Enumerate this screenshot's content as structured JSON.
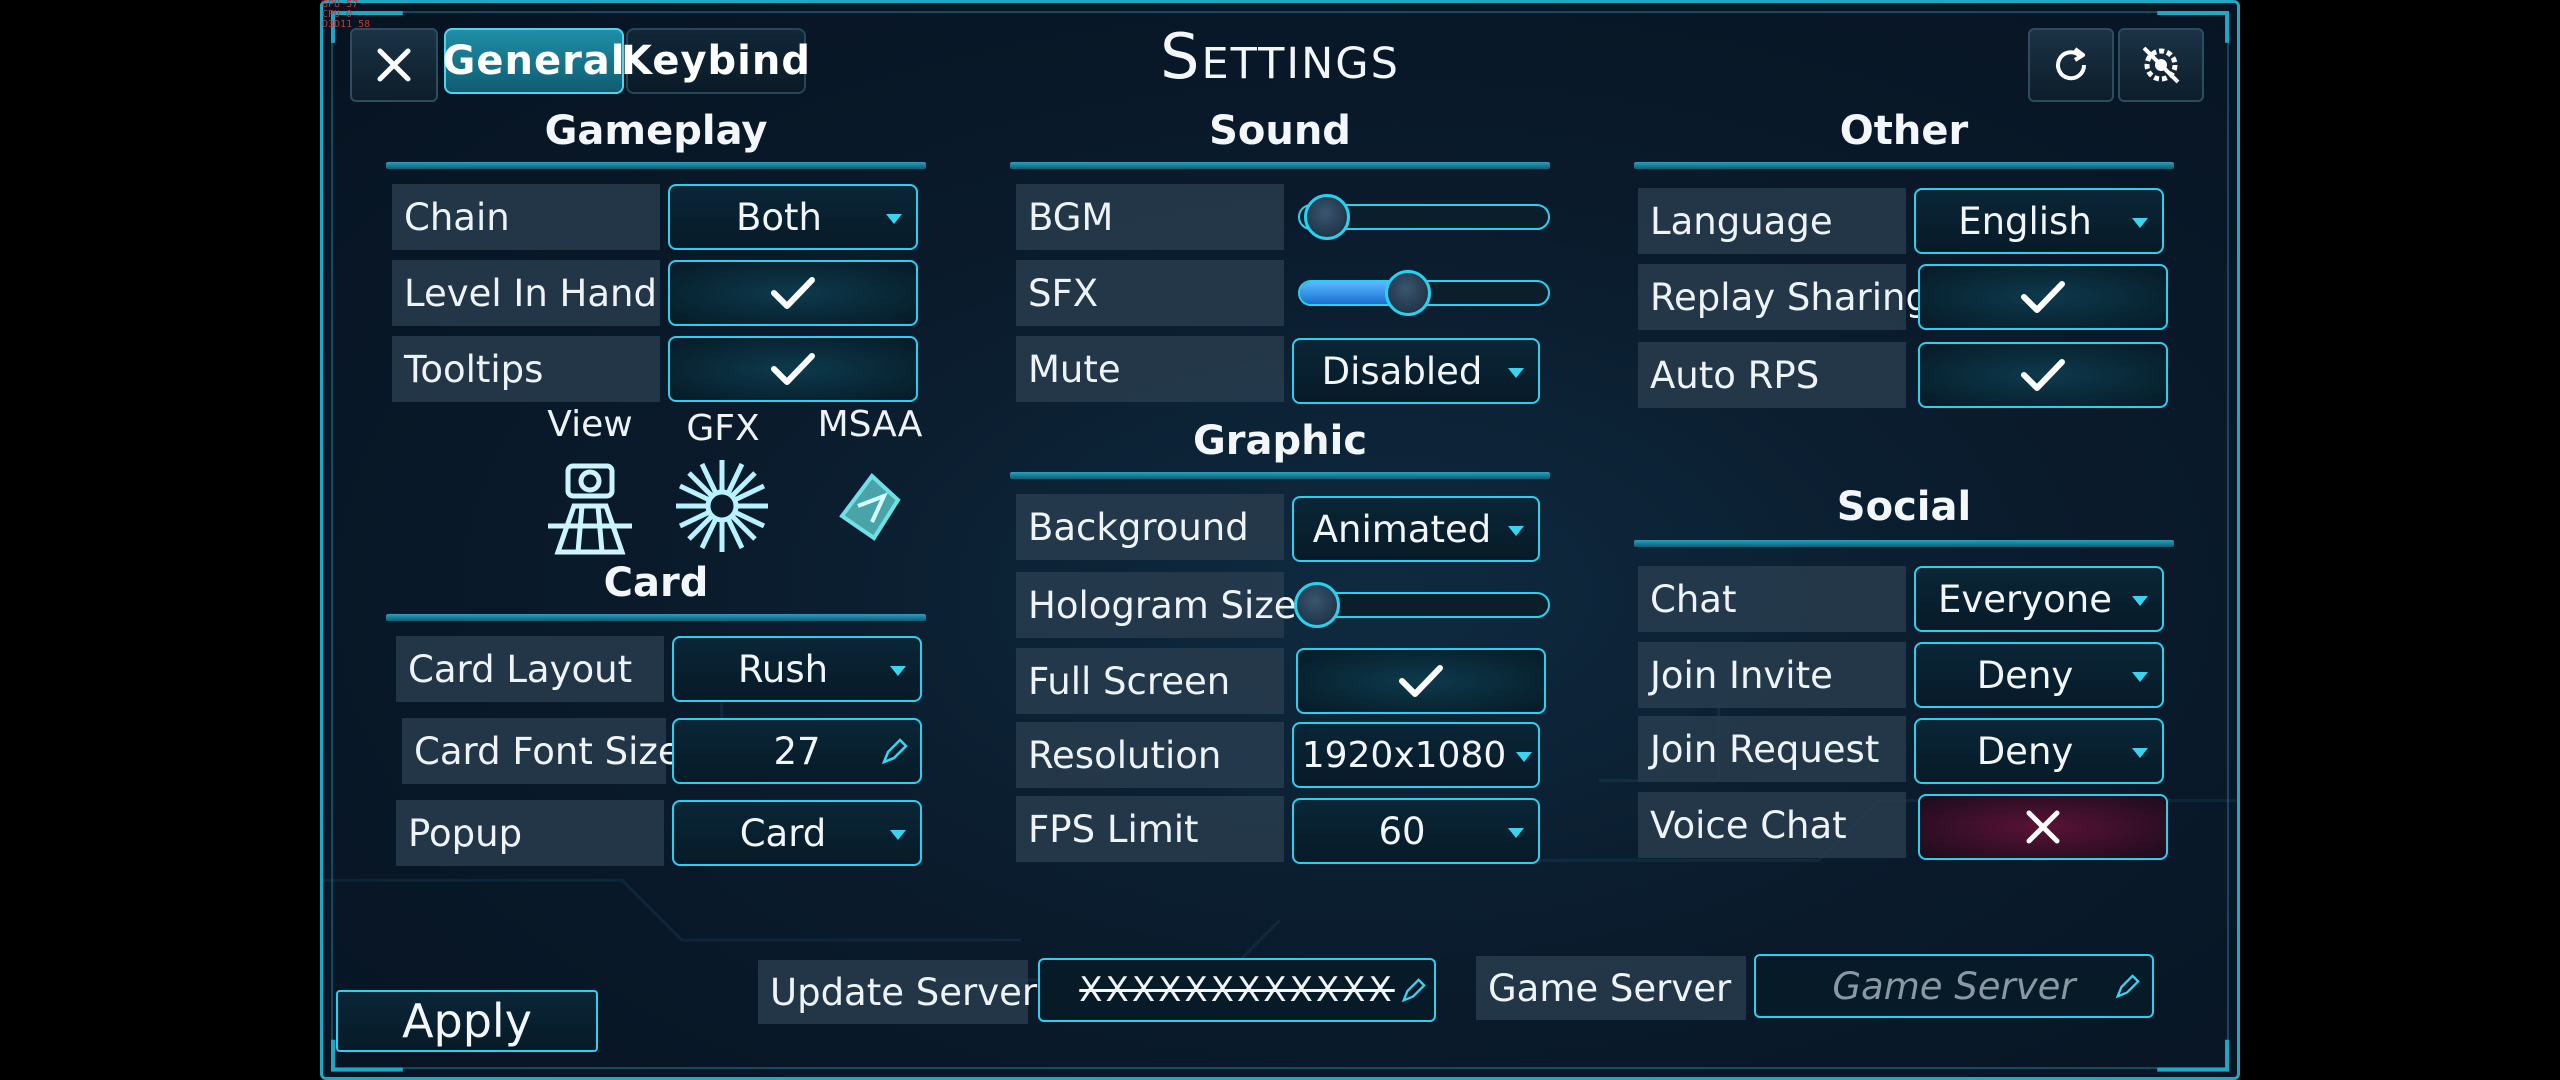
{
  "header": {
    "title": "Settings",
    "tabs": [
      "General",
      "Keybind"
    ],
    "icons": [
      "close-icon",
      "refresh-icon",
      "settings-off-icon"
    ]
  },
  "perf_overlay": [
    "GPU",
    "CPU",
    "D3D11",
    "57",
    "0",
    "58"
  ],
  "gameplay": {
    "title": "Gameplay",
    "chain": {
      "label": "Chain",
      "value": "Both"
    },
    "level_in_hand": {
      "label": "Level In Hand",
      "checked": true
    },
    "tooltips": {
      "label": "Tooltips",
      "checked": true
    },
    "icons": [
      {
        "label": "View",
        "icon": "camera-platform-icon"
      },
      {
        "label": "GFX",
        "icon": "starburst-icon"
      },
      {
        "label": "MSAA",
        "icon": "crystal-icon"
      }
    ]
  },
  "card": {
    "title": "Card",
    "layout": {
      "label": "Card Layout",
      "value": "Rush"
    },
    "font_size": {
      "label": "Card Font Size",
      "value": "27"
    },
    "popup": {
      "label": "Popup",
      "value": "Card"
    }
  },
  "sound": {
    "title": "Sound",
    "bgm": {
      "label": "BGM",
      "level": 0.05
    },
    "sfx": {
      "label": "SFX",
      "level": 0.45
    },
    "mute": {
      "label": "Mute",
      "value": "Disabled"
    }
  },
  "graphic": {
    "title": "Graphic",
    "background": {
      "label": "Background",
      "value": "Animated"
    },
    "hologram_size": {
      "label": "Hologram Size",
      "level": 0.0
    },
    "full_screen": {
      "label": "Full Screen",
      "checked": true
    },
    "resolution": {
      "label": "Resolution",
      "value": "1920x1080"
    },
    "fps_limit": {
      "label": "FPS Limit",
      "value": "60"
    }
  },
  "other": {
    "title": "Other",
    "language": {
      "label": "Language",
      "value": "English"
    },
    "replay_sharing": {
      "label": "Replay Sharing",
      "checked": true
    },
    "auto_rps": {
      "label": "Auto RPS",
      "checked": true
    }
  },
  "social": {
    "title": "Social",
    "chat": {
      "label": "Chat",
      "value": "Everyone"
    },
    "join_invite": {
      "label": "Join Invite",
      "value": "Deny"
    },
    "join_request": {
      "label": "Join Request",
      "value": "Deny"
    },
    "voice_chat": {
      "label": "Voice Chat",
      "checked": false
    }
  },
  "footer": {
    "apply": "Apply",
    "update_server": {
      "label": "Update Server",
      "value": "XXXXXXXXXXXX"
    },
    "game_server": {
      "label": "Game Server",
      "placeholder": "Game Server"
    }
  },
  "colors": {
    "accent": "#2ad1ef",
    "panel": "#0a1b2c",
    "active_tab": "#1f8ea6",
    "off": "#5a1236"
  }
}
